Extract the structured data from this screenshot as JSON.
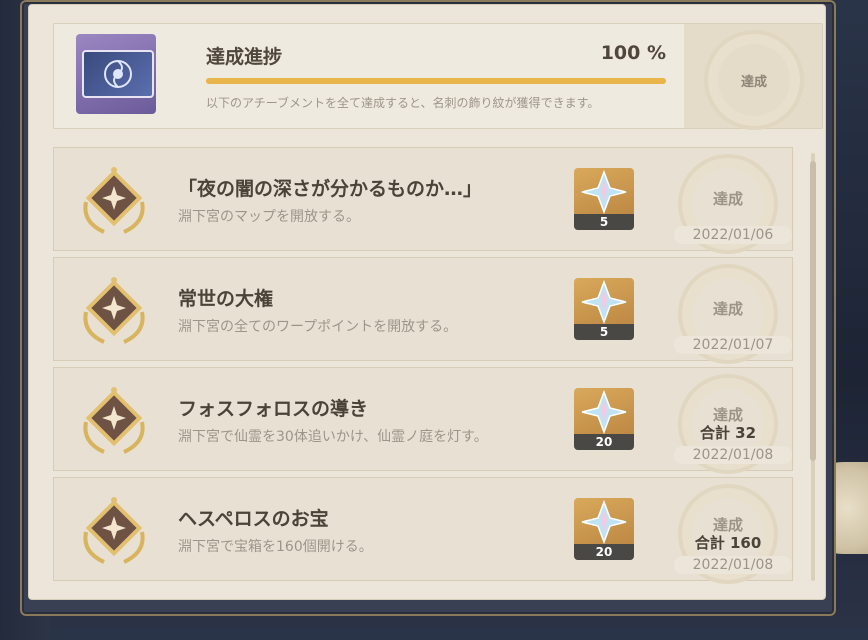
{
  "header": {
    "progress_title": "達成進捗",
    "progress_value": "100 %",
    "progress_fraction": 1.0,
    "description": "以下のアチーブメントを全て達成すると、名刺の飾り紋が獲得できます。",
    "status": "達成",
    "namecard_icon": "namecard-emblem-icon"
  },
  "achievements": [
    {
      "title": "「夜の闇の深さが分かるものか…」",
      "desc": "淵下宮のマップを開放する。",
      "reward_icon": "primogem-icon",
      "reward_count": "5",
      "status": "達成",
      "total": "",
      "date": "2022/01/06"
    },
    {
      "title": "常世の大権",
      "desc": "淵下宮の全てのワープポイントを開放する。",
      "reward_icon": "primogem-icon",
      "reward_count": "5",
      "status": "達成",
      "total": "",
      "date": "2022/01/07"
    },
    {
      "title": "フォスフォロスの導き",
      "desc": "淵下宮で仙霊を30体追いかけ、仙霊ノ庭を灯す。",
      "reward_icon": "primogem-icon",
      "reward_count": "20",
      "status": "達成",
      "total": "合計 32",
      "date": "2022/01/08"
    },
    {
      "title": "ヘスペロスのお宝",
      "desc": "淵下宮で宝箱を160個開ける。",
      "reward_icon": "primogem-icon",
      "reward_count": "20",
      "status": "達成",
      "total": "合計 160",
      "date": "2022/01/08"
    }
  ],
  "colors": {
    "accent": "#e7b54a",
    "panel": "#ece6da",
    "text": "#4b4238",
    "muted": "#9e958a"
  }
}
